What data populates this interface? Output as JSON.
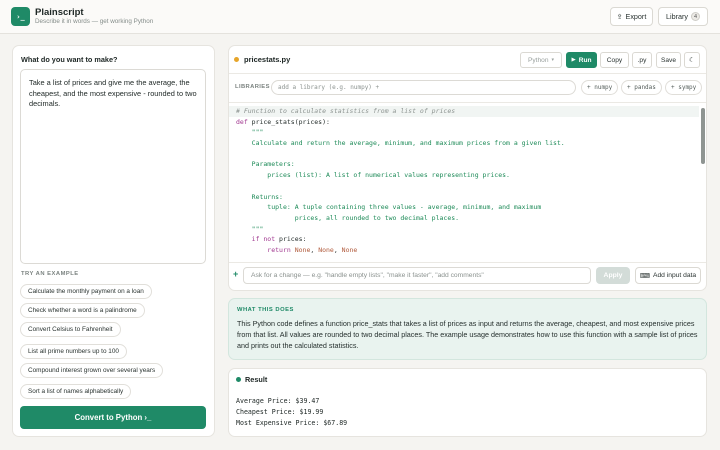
{
  "app": {
    "title": "Plainscript",
    "subtitle": "Describe it in words — get working Python",
    "logo_glyph": "›_"
  },
  "header": {
    "export_label": "Export",
    "export_icon": "arrow-glyph",
    "library_label": "Library",
    "library_count": "4"
  },
  "left": {
    "question": "What do you want to make?",
    "prompt_text": "Take a list of prices and give me the average, the cheapest, and the most expensive - rounded to two decimals.",
    "try_label": "TRY AN EXAMPLE",
    "examples": [
      "Calculate the monthly payment on a loan",
      "Check whether a word is a palindrome",
      "Convert Celsius to Fahrenheit",
      "List all prime numbers up to 100",
      "Compound interest grown over several years",
      "Sort a list of names alphabetically"
    ],
    "convert_label": "Convert to Python ›_"
  },
  "editor": {
    "filename": "pricestats.py",
    "language": "Python",
    "run_label": "Run",
    "copy_label": "Copy",
    "ext_label": ".py",
    "save_label": "Save",
    "theme_glyph": "☾",
    "libraries_label": "LIBRARIES",
    "library_placeholder": "add a library (e.g. numpy) +",
    "library_suggestions": [
      "+ numpy",
      "+ pandas",
      "+ sympy"
    ]
  },
  "code_lines": [
    [
      {
        "t": "# Function to calculate statistics from a list of prices",
        "c": "cm"
      }
    ],
    [
      {
        "t": "def ",
        "c": "kw"
      },
      {
        "t": "price_stats(prices):",
        "c": "fn"
      }
    ],
    [
      {
        "t": "    \"\"\"",
        "c": "st"
      }
    ],
    [
      {
        "t": "    Calculate and return the average, minimum, and maximum prices from a given list.",
        "c": "st"
      }
    ],
    [
      {
        "t": "",
        "c": "pl"
      }
    ],
    [
      {
        "t": "    Parameters:",
        "c": "st"
      }
    ],
    [
      {
        "t": "        prices (list): A list of numerical values representing prices.",
        "c": "st"
      }
    ],
    [
      {
        "t": "",
        "c": "pl"
      }
    ],
    [
      {
        "t": "    Returns:",
        "c": "st"
      }
    ],
    [
      {
        "t": "        tuple: A tuple containing three values - average, minimum, and maximum",
        "c": "st"
      }
    ],
    [
      {
        "t": "               prices, all rounded to two decimal places.",
        "c": "st"
      }
    ],
    [
      {
        "t": "    \"\"\"",
        "c": "st"
      }
    ],
    [
      {
        "t": "    if not ",
        "c": "kw"
      },
      {
        "t": "prices:",
        "c": "pl"
      }
    ],
    [
      {
        "t": "        return ",
        "c": "kw"
      },
      {
        "t": "None",
        "c": "cn"
      },
      {
        "t": ", ",
        "c": "pl"
      },
      {
        "t": "None",
        "c": "cn"
      },
      {
        "t": ", ",
        "c": "pl"
      },
      {
        "t": "None",
        "c": "cn"
      }
    ]
  ],
  "change": {
    "placeholder": "Ask for a change — e.g. \"handle empty lists\", \"make it faster\", \"add comments\"",
    "apply_label": "Apply",
    "add_input_label": "Add input data"
  },
  "explain": {
    "label": "WHAT THIS DOES",
    "text": "This Python code defines a function price_stats that takes a list of prices as input and returns the average, cheapest, and most expensive prices from that list. All values are rounded to two decimal places. The example usage demonstrates how to use this function with a sample list of prices and prints out the calculated statistics."
  },
  "result": {
    "label": "Result",
    "lines": [
      "Average Price: $39.47",
      "Cheapest Price: $19.99",
      "Most Expensive Price: $67.89"
    ]
  }
}
